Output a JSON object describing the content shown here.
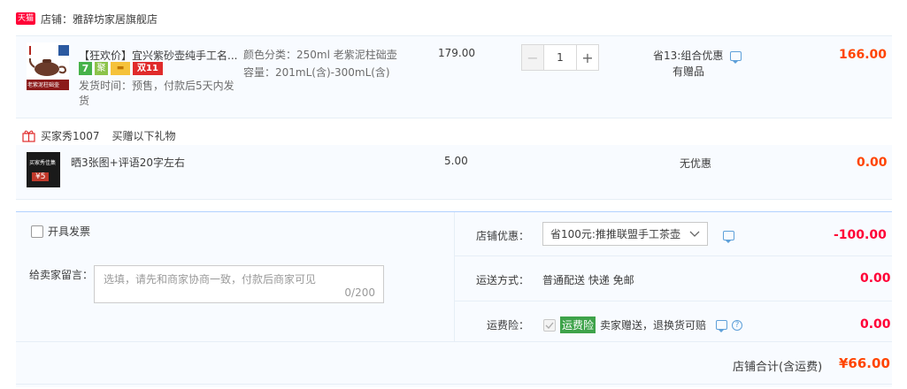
{
  "shop": {
    "badge": "天猫",
    "label": "店铺：雅辞坊家居旗舰店"
  },
  "item": {
    "title": "【狂欢价】宜兴紫砂壶纯手工名...",
    "delivery": "发货时间：预售，付款后5天内发货",
    "sku_color": "颜色分类：250ml 老紫泥柱础壶",
    "sku_capacity": "容量：201mL(含)-300mL(含)",
    "unit_price": "179.00",
    "qty_minus": "−",
    "qty": "1",
    "qty_plus": "+",
    "promo": "省13:组合优惠",
    "gift_note": "有赠品",
    "subtotal": "166.00",
    "thumb_text": "老紫泥柱础壶",
    "badge_7": "7",
    "badge_ju": "聚",
    "badge_card": "▬",
    "badge_double11": "双11"
  },
  "gift_header": {
    "buyer": "买家秀1007",
    "text": "买赠以下礼物"
  },
  "gift": {
    "title": "晒3张图+评语20字左右",
    "price": "5.00",
    "promo": "无优惠",
    "subtotal": "0.00",
    "thumb_line1": "买家秀佳集",
    "thumb_line2": "¥5"
  },
  "invoice": {
    "label": "开具发票"
  },
  "message": {
    "label": "给卖家留言：",
    "placeholder": "选填，请先和商家协商一致，付款后商家可见",
    "counter": "0/200"
  },
  "discount": {
    "label": "店铺优惠：",
    "value": "省100元:推推联盟手工茶壶",
    "amount": "-100.00"
  },
  "shipping": {
    "label": "运送方式：",
    "value": "普通配送 快递 免邮",
    "amount": "0.00"
  },
  "insurance": {
    "label": "运费险：",
    "badge": "运费险",
    "text": "卖家赠送，退换货可赔",
    "amount": "0.00"
  },
  "total": {
    "label": "店铺合计(含运费)",
    "value": "¥66.00"
  },
  "colors": {
    "accent": "#ff4400",
    "total_red": "#ff0036",
    "green": "#3ea34a"
  }
}
